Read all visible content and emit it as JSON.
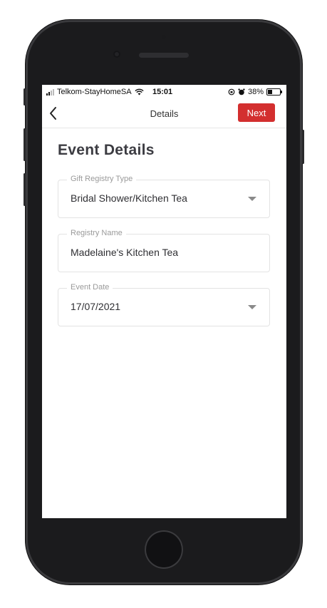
{
  "status_bar": {
    "carrier": "Telkom-StayHomeSA",
    "time": "15:01",
    "battery": "38%",
    "battery_level": 0.38
  },
  "nav": {
    "title": "Details",
    "next_label": "Next",
    "back_icon": "chevron-left-icon"
  },
  "page": {
    "heading": "Event Details"
  },
  "form": {
    "registry_type": {
      "label": "Gift Registry Type",
      "value": "Bridal Shower/Kitchen Tea"
    },
    "registry_name": {
      "label": "Registry Name",
      "value": "Madelaine's Kitchen Tea"
    },
    "event_date": {
      "label": "Event Date",
      "value": "17/07/2021"
    }
  },
  "colors": {
    "accent": "#d32f2f",
    "heading": "#3c3c42"
  }
}
